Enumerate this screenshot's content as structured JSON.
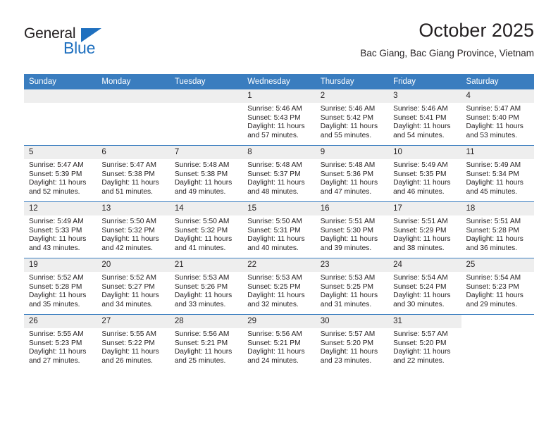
{
  "brand": {
    "name_dark": "General",
    "name_blue": "Blue",
    "accent_color": "#1f70bf"
  },
  "header": {
    "title": "October 2025",
    "subtitle": "Bac Giang, Bac Giang Province, Vietnam"
  },
  "calendar": {
    "header_bg": "#3a7dbf",
    "daynum_bg": "#eeeeee",
    "weekday_headers": [
      "Sunday",
      "Monday",
      "Tuesday",
      "Wednesday",
      "Thursday",
      "Friday",
      "Saturday"
    ],
    "labels": {
      "sunrise": "Sunrise:",
      "sunset": "Sunset:",
      "daylight": "Daylight:"
    },
    "weeks": [
      [
        {
          "empty": true
        },
        {
          "empty": true
        },
        {
          "empty": true
        },
        {
          "day": "1",
          "sunrise": "Sunrise: 5:46 AM",
          "sunset": "Sunset: 5:43 PM",
          "daylight_1": "Daylight: 11 hours",
          "daylight_2": "and 57 minutes."
        },
        {
          "day": "2",
          "sunrise": "Sunrise: 5:46 AM",
          "sunset": "Sunset: 5:42 PM",
          "daylight_1": "Daylight: 11 hours",
          "daylight_2": "and 55 minutes."
        },
        {
          "day": "3",
          "sunrise": "Sunrise: 5:46 AM",
          "sunset": "Sunset: 5:41 PM",
          "daylight_1": "Daylight: 11 hours",
          "daylight_2": "and 54 minutes."
        },
        {
          "day": "4",
          "sunrise": "Sunrise: 5:47 AM",
          "sunset": "Sunset: 5:40 PM",
          "daylight_1": "Daylight: 11 hours",
          "daylight_2": "and 53 minutes."
        }
      ],
      [
        {
          "day": "5",
          "sunrise": "Sunrise: 5:47 AM",
          "sunset": "Sunset: 5:39 PM",
          "daylight_1": "Daylight: 11 hours",
          "daylight_2": "and 52 minutes."
        },
        {
          "day": "6",
          "sunrise": "Sunrise: 5:47 AM",
          "sunset": "Sunset: 5:38 PM",
          "daylight_1": "Daylight: 11 hours",
          "daylight_2": "and 51 minutes."
        },
        {
          "day": "7",
          "sunrise": "Sunrise: 5:48 AM",
          "sunset": "Sunset: 5:38 PM",
          "daylight_1": "Daylight: 11 hours",
          "daylight_2": "and 49 minutes."
        },
        {
          "day": "8",
          "sunrise": "Sunrise: 5:48 AM",
          "sunset": "Sunset: 5:37 PM",
          "daylight_1": "Daylight: 11 hours",
          "daylight_2": "and 48 minutes."
        },
        {
          "day": "9",
          "sunrise": "Sunrise: 5:48 AM",
          "sunset": "Sunset: 5:36 PM",
          "daylight_1": "Daylight: 11 hours",
          "daylight_2": "and 47 minutes."
        },
        {
          "day": "10",
          "sunrise": "Sunrise: 5:49 AM",
          "sunset": "Sunset: 5:35 PM",
          "daylight_1": "Daylight: 11 hours",
          "daylight_2": "and 46 minutes."
        },
        {
          "day": "11",
          "sunrise": "Sunrise: 5:49 AM",
          "sunset": "Sunset: 5:34 PM",
          "daylight_1": "Daylight: 11 hours",
          "daylight_2": "and 45 minutes."
        }
      ],
      [
        {
          "day": "12",
          "sunrise": "Sunrise: 5:49 AM",
          "sunset": "Sunset: 5:33 PM",
          "daylight_1": "Daylight: 11 hours",
          "daylight_2": "and 43 minutes."
        },
        {
          "day": "13",
          "sunrise": "Sunrise: 5:50 AM",
          "sunset": "Sunset: 5:32 PM",
          "daylight_1": "Daylight: 11 hours",
          "daylight_2": "and 42 minutes."
        },
        {
          "day": "14",
          "sunrise": "Sunrise: 5:50 AM",
          "sunset": "Sunset: 5:32 PM",
          "daylight_1": "Daylight: 11 hours",
          "daylight_2": "and 41 minutes."
        },
        {
          "day": "15",
          "sunrise": "Sunrise: 5:50 AM",
          "sunset": "Sunset: 5:31 PM",
          "daylight_1": "Daylight: 11 hours",
          "daylight_2": "and 40 minutes."
        },
        {
          "day": "16",
          "sunrise": "Sunrise: 5:51 AM",
          "sunset": "Sunset: 5:30 PM",
          "daylight_1": "Daylight: 11 hours",
          "daylight_2": "and 39 minutes."
        },
        {
          "day": "17",
          "sunrise": "Sunrise: 5:51 AM",
          "sunset": "Sunset: 5:29 PM",
          "daylight_1": "Daylight: 11 hours",
          "daylight_2": "and 38 minutes."
        },
        {
          "day": "18",
          "sunrise": "Sunrise: 5:51 AM",
          "sunset": "Sunset: 5:28 PM",
          "daylight_1": "Daylight: 11 hours",
          "daylight_2": "and 36 minutes."
        }
      ],
      [
        {
          "day": "19",
          "sunrise": "Sunrise: 5:52 AM",
          "sunset": "Sunset: 5:28 PM",
          "daylight_1": "Daylight: 11 hours",
          "daylight_2": "and 35 minutes."
        },
        {
          "day": "20",
          "sunrise": "Sunrise: 5:52 AM",
          "sunset": "Sunset: 5:27 PM",
          "daylight_1": "Daylight: 11 hours",
          "daylight_2": "and 34 minutes."
        },
        {
          "day": "21",
          "sunrise": "Sunrise: 5:53 AM",
          "sunset": "Sunset: 5:26 PM",
          "daylight_1": "Daylight: 11 hours",
          "daylight_2": "and 33 minutes."
        },
        {
          "day": "22",
          "sunrise": "Sunrise: 5:53 AM",
          "sunset": "Sunset: 5:25 PM",
          "daylight_1": "Daylight: 11 hours",
          "daylight_2": "and 32 minutes."
        },
        {
          "day": "23",
          "sunrise": "Sunrise: 5:53 AM",
          "sunset": "Sunset: 5:25 PM",
          "daylight_1": "Daylight: 11 hours",
          "daylight_2": "and 31 minutes."
        },
        {
          "day": "24",
          "sunrise": "Sunrise: 5:54 AM",
          "sunset": "Sunset: 5:24 PM",
          "daylight_1": "Daylight: 11 hours",
          "daylight_2": "and 30 minutes."
        },
        {
          "day": "25",
          "sunrise": "Sunrise: 5:54 AM",
          "sunset": "Sunset: 5:23 PM",
          "daylight_1": "Daylight: 11 hours",
          "daylight_2": "and 29 minutes."
        }
      ],
      [
        {
          "day": "26",
          "sunrise": "Sunrise: 5:55 AM",
          "sunset": "Sunset: 5:23 PM",
          "daylight_1": "Daylight: 11 hours",
          "daylight_2": "and 27 minutes."
        },
        {
          "day": "27",
          "sunrise": "Sunrise: 5:55 AM",
          "sunset": "Sunset: 5:22 PM",
          "daylight_1": "Daylight: 11 hours",
          "daylight_2": "and 26 minutes."
        },
        {
          "day": "28",
          "sunrise": "Sunrise: 5:56 AM",
          "sunset": "Sunset: 5:21 PM",
          "daylight_1": "Daylight: 11 hours",
          "daylight_2": "and 25 minutes."
        },
        {
          "day": "29",
          "sunrise": "Sunrise: 5:56 AM",
          "sunset": "Sunset: 5:21 PM",
          "daylight_1": "Daylight: 11 hours",
          "daylight_2": "and 24 minutes."
        },
        {
          "day": "30",
          "sunrise": "Sunrise: 5:57 AM",
          "sunset": "Sunset: 5:20 PM",
          "daylight_1": "Daylight: 11 hours",
          "daylight_2": "and 23 minutes."
        },
        {
          "day": "31",
          "sunrise": "Sunrise: 5:57 AM",
          "sunset": "Sunset: 5:20 PM",
          "daylight_1": "Daylight: 11 hours",
          "daylight_2": "and 22 minutes."
        },
        {
          "empty": true,
          "no_band": true
        }
      ]
    ]
  }
}
